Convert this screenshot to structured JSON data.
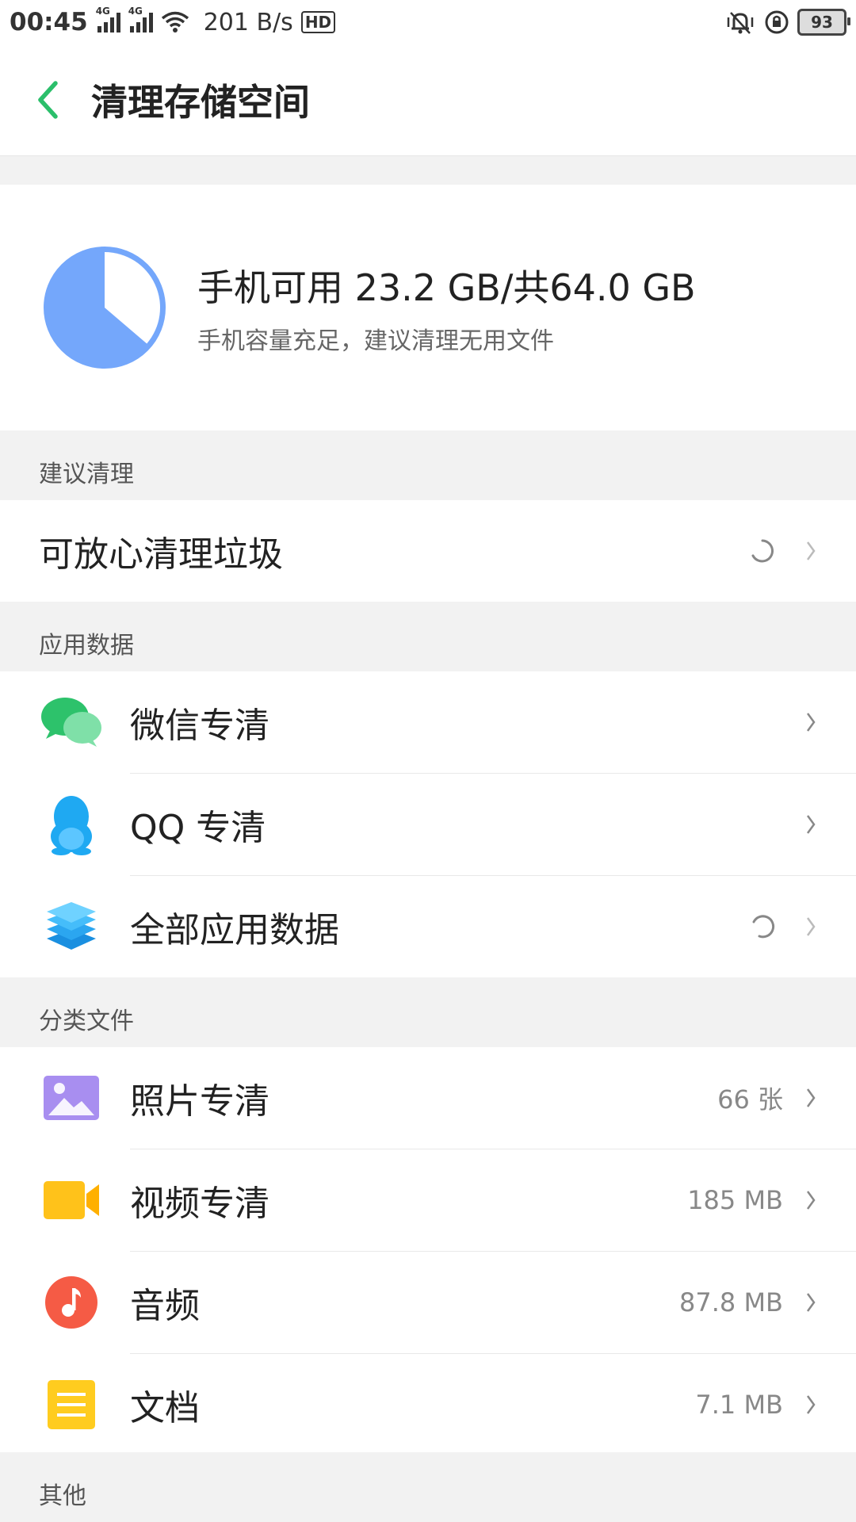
{
  "status_bar": {
    "time": "00:45",
    "net1": "4G",
    "net2": "4G",
    "speed": "201 B/s",
    "hd": "HD",
    "battery": "93"
  },
  "header": {
    "title": "清理存储空间",
    "back_icon": "chevron-left-icon",
    "accent_color": "#2bbf6b"
  },
  "storage": {
    "main": "手机可用 23.2 GB/共64.0 GB",
    "sub": "手机容量充足，建议清理无用文件",
    "used_fraction": 0.6375,
    "pie_color": "#74a7fb"
  },
  "sections": {
    "suggested": "建议清理",
    "app_data": "应用数据",
    "categories": "分类文件",
    "other": "其他"
  },
  "items": {
    "junk": {
      "label": "可放心清理垃圾",
      "status": "loading"
    },
    "wechat": {
      "label": "微信专清",
      "icon": "wechat-icon"
    },
    "qq": {
      "label": "QQ 专清",
      "icon": "qq-penguin-icon"
    },
    "all_apps": {
      "label": "全部应用数据",
      "icon": "layers-icon",
      "status": "loading"
    },
    "photos": {
      "label": "照片专清",
      "value": "66 张",
      "icon": "photo-icon"
    },
    "videos": {
      "label": "视频专清",
      "value": "185 MB",
      "icon": "video-camera-icon"
    },
    "audio": {
      "label": "音频",
      "value": "87.8 MB",
      "icon": "music-note-icon"
    },
    "docs": {
      "label": "文档",
      "value": "7.1 MB",
      "icon": "document-icon"
    }
  }
}
